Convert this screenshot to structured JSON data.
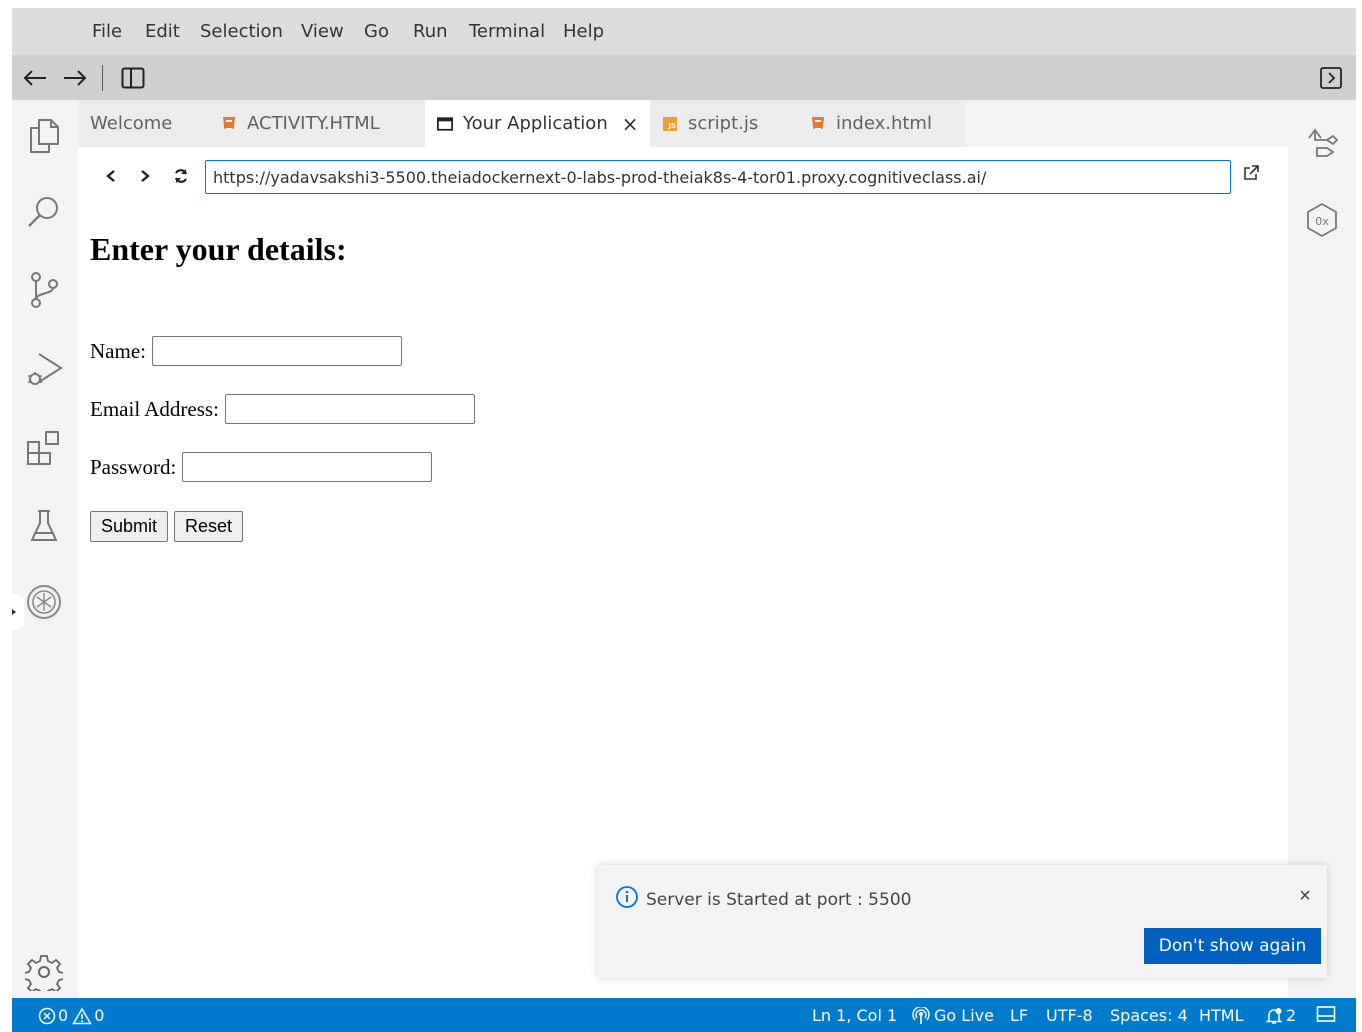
{
  "menu": [
    "File",
    "Edit",
    "Selection",
    "View",
    "Go",
    "Run",
    "Terminal",
    "Help"
  ],
  "tabs": [
    {
      "label": "Welcome",
      "icon": "none"
    },
    {
      "label": "ACTIVITY.HTML",
      "icon": "html5-icon"
    },
    {
      "label": "Your Application",
      "icon": "browser-window-icon",
      "active": true
    },
    {
      "label": "script.js",
      "icon": "js-file-icon"
    },
    {
      "label": "index.html",
      "icon": "html5-icon"
    }
  ],
  "browser": {
    "url": "https://yadavsakshi3-5500.theiadockernext-0-labs-prod-theiak8s-4-tor01.proxy.cognitiveclass.ai/"
  },
  "form": {
    "heading": "Enter your details:",
    "name_label": "Name:",
    "email_label": "Email Address:",
    "password_label": "Password:",
    "submit_label": "Submit",
    "reset_label": "Reset"
  },
  "notification": {
    "message": "Server is Started at port : 5500",
    "button": "Don't show again"
  },
  "status": {
    "errors": "0",
    "warnings": "0",
    "position": "Ln 1, Col 1",
    "go_live": "Go Live",
    "eol": "LF",
    "encoding": "UTF-8",
    "spaces": "Spaces: 4",
    "language": "HTML",
    "notifications": "2"
  },
  "colors": {
    "status_bar": "#007acc",
    "primary_button": "#0060c0",
    "html_icon": "#e37933",
    "js_icon": "#e8a032"
  }
}
